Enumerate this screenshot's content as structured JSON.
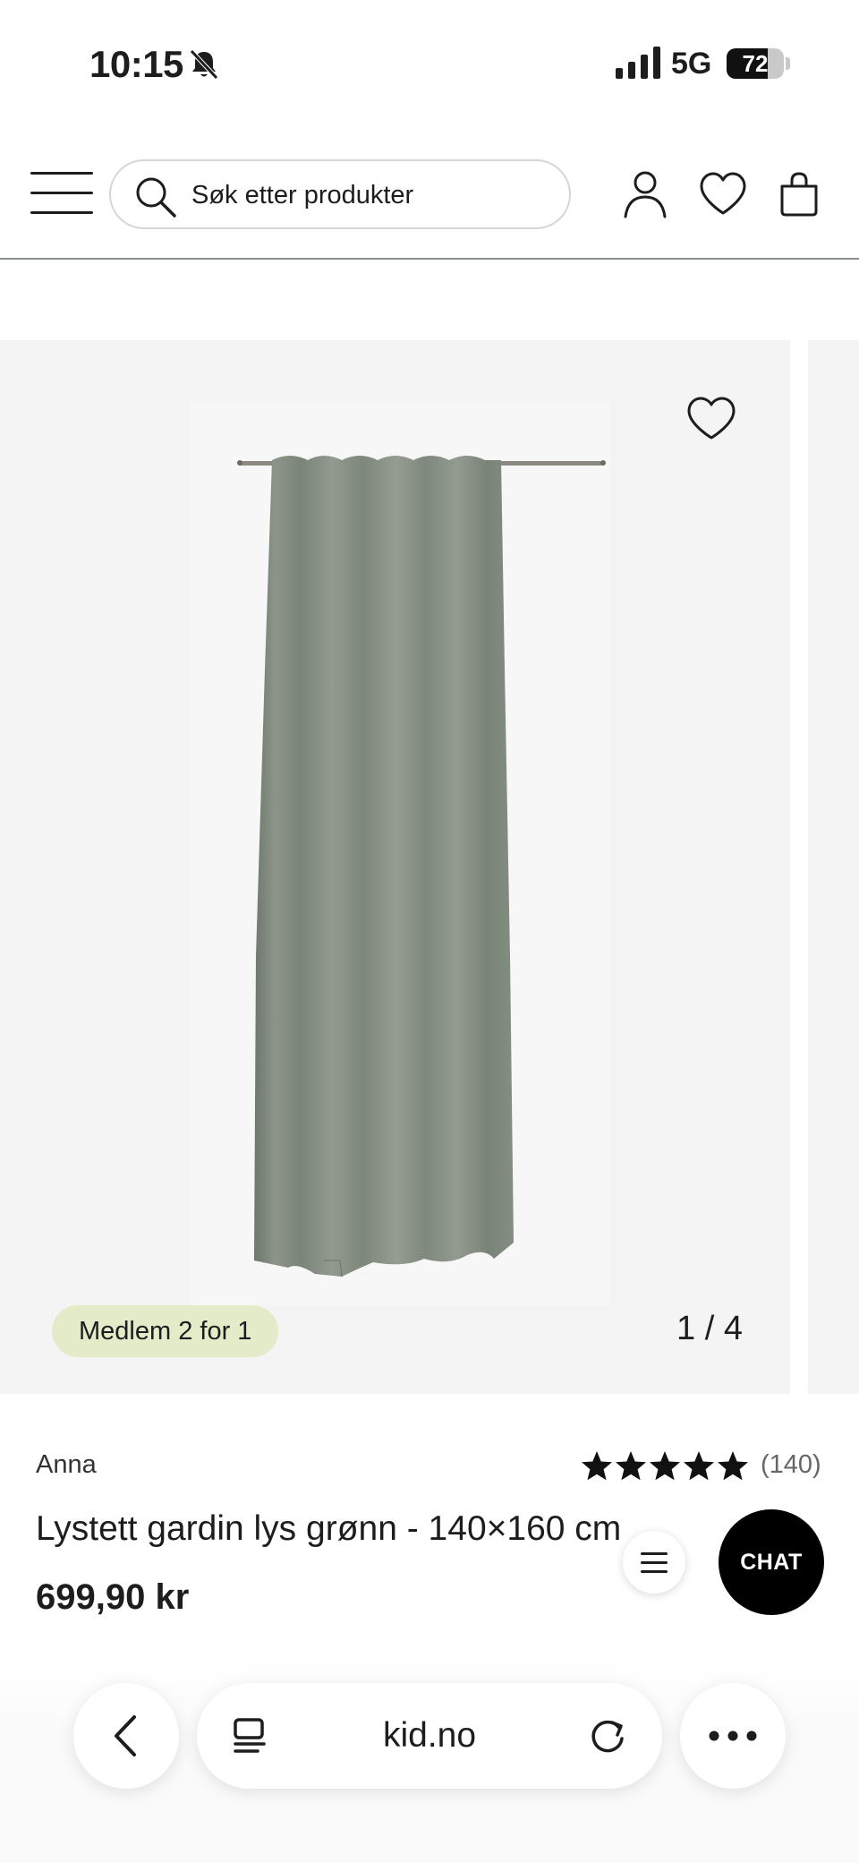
{
  "status_bar": {
    "time": "10:15",
    "network": "5G",
    "battery": "72",
    "battery_level": 0.72
  },
  "header": {
    "search_placeholder": "Søk etter produkter",
    "icons": [
      "menu-icon",
      "search-icon",
      "user-icon",
      "heart-icon",
      "bag-icon"
    ]
  },
  "gallery": {
    "badge": "Medlem 2 for 1",
    "counter": "1 / 4",
    "current_image": 1,
    "total_images": 4,
    "image_alt": "Lystett gardin lys grønn",
    "curtain_color": "#8a9386",
    "badge_color": "#e3ebc8"
  },
  "product": {
    "brand": "Anna",
    "rating_stars": 5,
    "review_count": "(140)",
    "title": "Lystett gardin lys grønn - 140×160 cm",
    "price": "699,90 kr"
  },
  "chat": {
    "label": "CHAT"
  },
  "browser": {
    "url": "kid.no",
    "icons": [
      "back-icon",
      "reader-icon",
      "reload-icon",
      "more-icon"
    ]
  }
}
